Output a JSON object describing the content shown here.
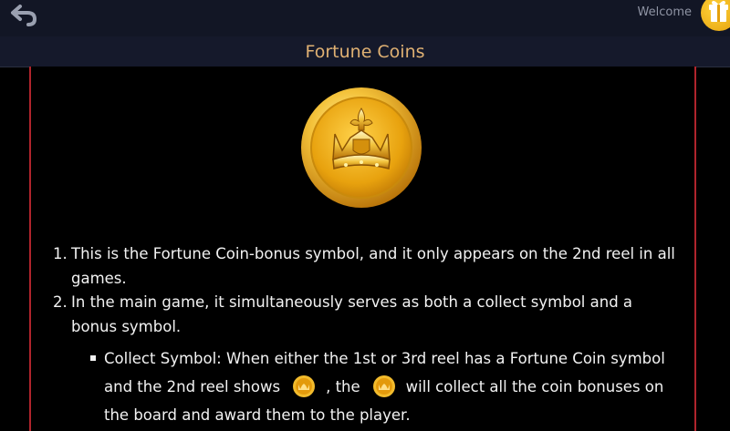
{
  "header": {
    "back_icon": "back-arrow-icon",
    "welcome": "Welcome",
    "gift_icon": "gift-icon"
  },
  "page": {
    "title": "Fortune Coins"
  },
  "symbol": {
    "icon": "fortune-coin-crown-icon"
  },
  "rules": {
    "item1_num": "1.",
    "item1_text": "This is the Fortune Coin-bonus symbol, and it only appears on the 2nd reel in all games.",
    "item2_num": "2.",
    "item2_text": "In the main game, it simultaneously serves as both a collect symbol and a bonus symbol.",
    "sub1_part1": "Collect Symbol: When either the 1st or 3rd reel has a Fortune Coin symbol and the 2nd reel shows",
    "sub1_part2": ", the",
    "sub1_part3": "will collect all the coin bonuses on the board and award them to the player."
  },
  "colors": {
    "title": "#e0b173",
    "panel_border": "#b0242c",
    "coin_gold": "#e8a20e"
  }
}
